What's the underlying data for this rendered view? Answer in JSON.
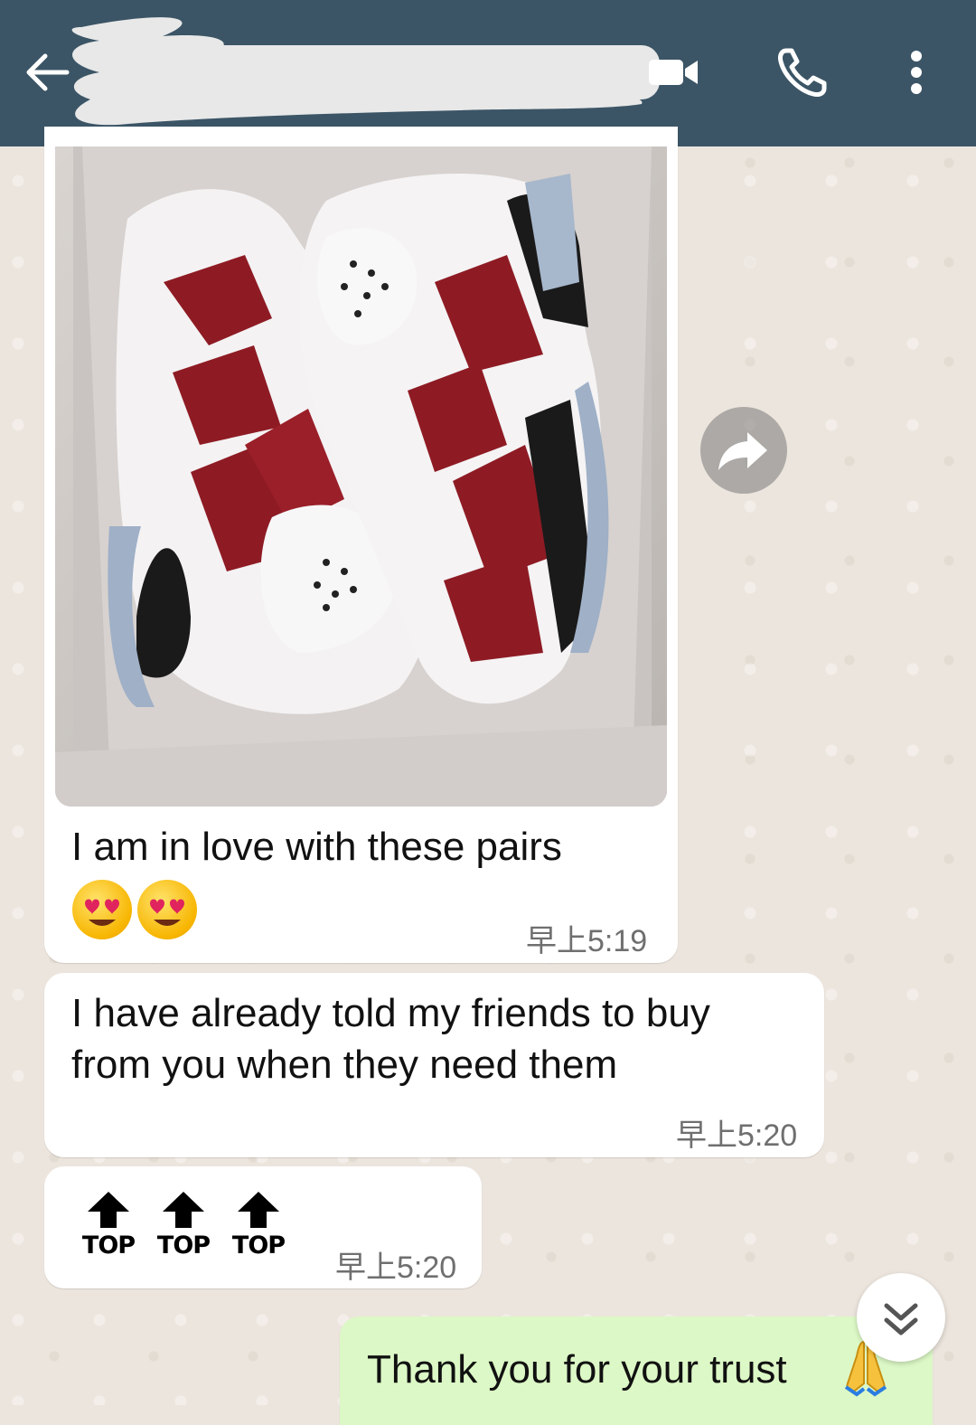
{
  "header": {
    "back_icon": "arrow-left-icon",
    "contact_name_redacted": true,
    "video_call_icon": "video-camera-icon",
    "voice_call_icon": "phone-icon",
    "menu_icon": "more-vert-icon",
    "bg_color": "#3b5566"
  },
  "messages": [
    {
      "direction": "incoming",
      "has_image": true,
      "image_subject": "red and white sneakers in a box",
      "text": "I am in love with these pairs",
      "emojis": [
        "😍",
        "😍"
      ],
      "time": "早上5:19"
    },
    {
      "direction": "incoming",
      "text_line1": "I have already told my friends to buy",
      "text_line2": "from you when they need them",
      "time": "早上5:20"
    },
    {
      "direction": "incoming",
      "top_labels": [
        "TOP",
        "TOP",
        "TOP"
      ],
      "time": "早上5:20"
    },
    {
      "direction": "outgoing",
      "text": "Thank you for your trust",
      "emoji": "🙏"
    }
  ],
  "controls": {
    "forward_icon": "forward-share-icon",
    "scroll_down_icon": "double-chevron-down-icon"
  },
  "colors": {
    "incoming_bubble": "#ffffff",
    "outgoing_bubble": "#dcf8c6",
    "chat_background": "#ece5dd"
  }
}
